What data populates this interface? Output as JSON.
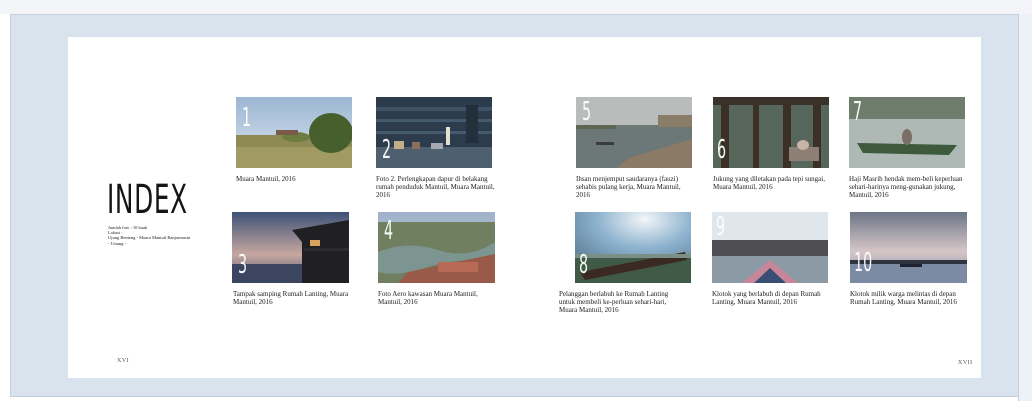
{
  "left_page": {
    "title": "INDEX",
    "info": [
      "Jumlah foto : 10 buah",
      "Lokasi :",
      "Ujung Benteng - Muara Mantuil Banjarmasin",
      "- Ustang -"
    ],
    "page_number": "XVI"
  },
  "right_page": {
    "page_number": "XVII"
  },
  "photos": [
    {
      "number": "1",
      "caption": "Muara Mantuil, 2016"
    },
    {
      "number": "2",
      "caption": "Foto 2. Perlengkapan dapur di belakang rumah penduduk Mantuil, Muara Mantuil, 2016"
    },
    {
      "number": "3",
      "caption": "Tampak samping Rumah Lanting, Muara Mantuil, 2016"
    },
    {
      "number": "4",
      "caption": "Foto Aero kawasan Muara Mantuil, Mantuil, 2016"
    },
    {
      "number": "5",
      "caption": "Ihsan menjemput saudaranya (fauzi) sehabis pulang kerja, Muara Mantuil, 2016"
    },
    {
      "number": "6",
      "caption": "Jukung yang diletakan pada tepi sungai, Muara Mantuil, 2016"
    },
    {
      "number": "7",
      "caption": "Haji Masrih hendak mem-beli keperluan sehari-harinya meng-gunakan jukung, Mantuil, 2016"
    },
    {
      "number": "8",
      "caption": "Pelanggan berlabuh ke Rumah Lanting untuk membeli ke-perluan sehari-hari, Muara Mantuil, 2016"
    },
    {
      "number": "9",
      "caption": "Klotok yang berlabuh di depan Rumah Lanting, Muara Mantuil, 2016"
    },
    {
      "number": "10",
      "caption": "Klotok milik warga melintas di depan Rumah Lanting, Muara Mantuil, 2016"
    }
  ]
}
